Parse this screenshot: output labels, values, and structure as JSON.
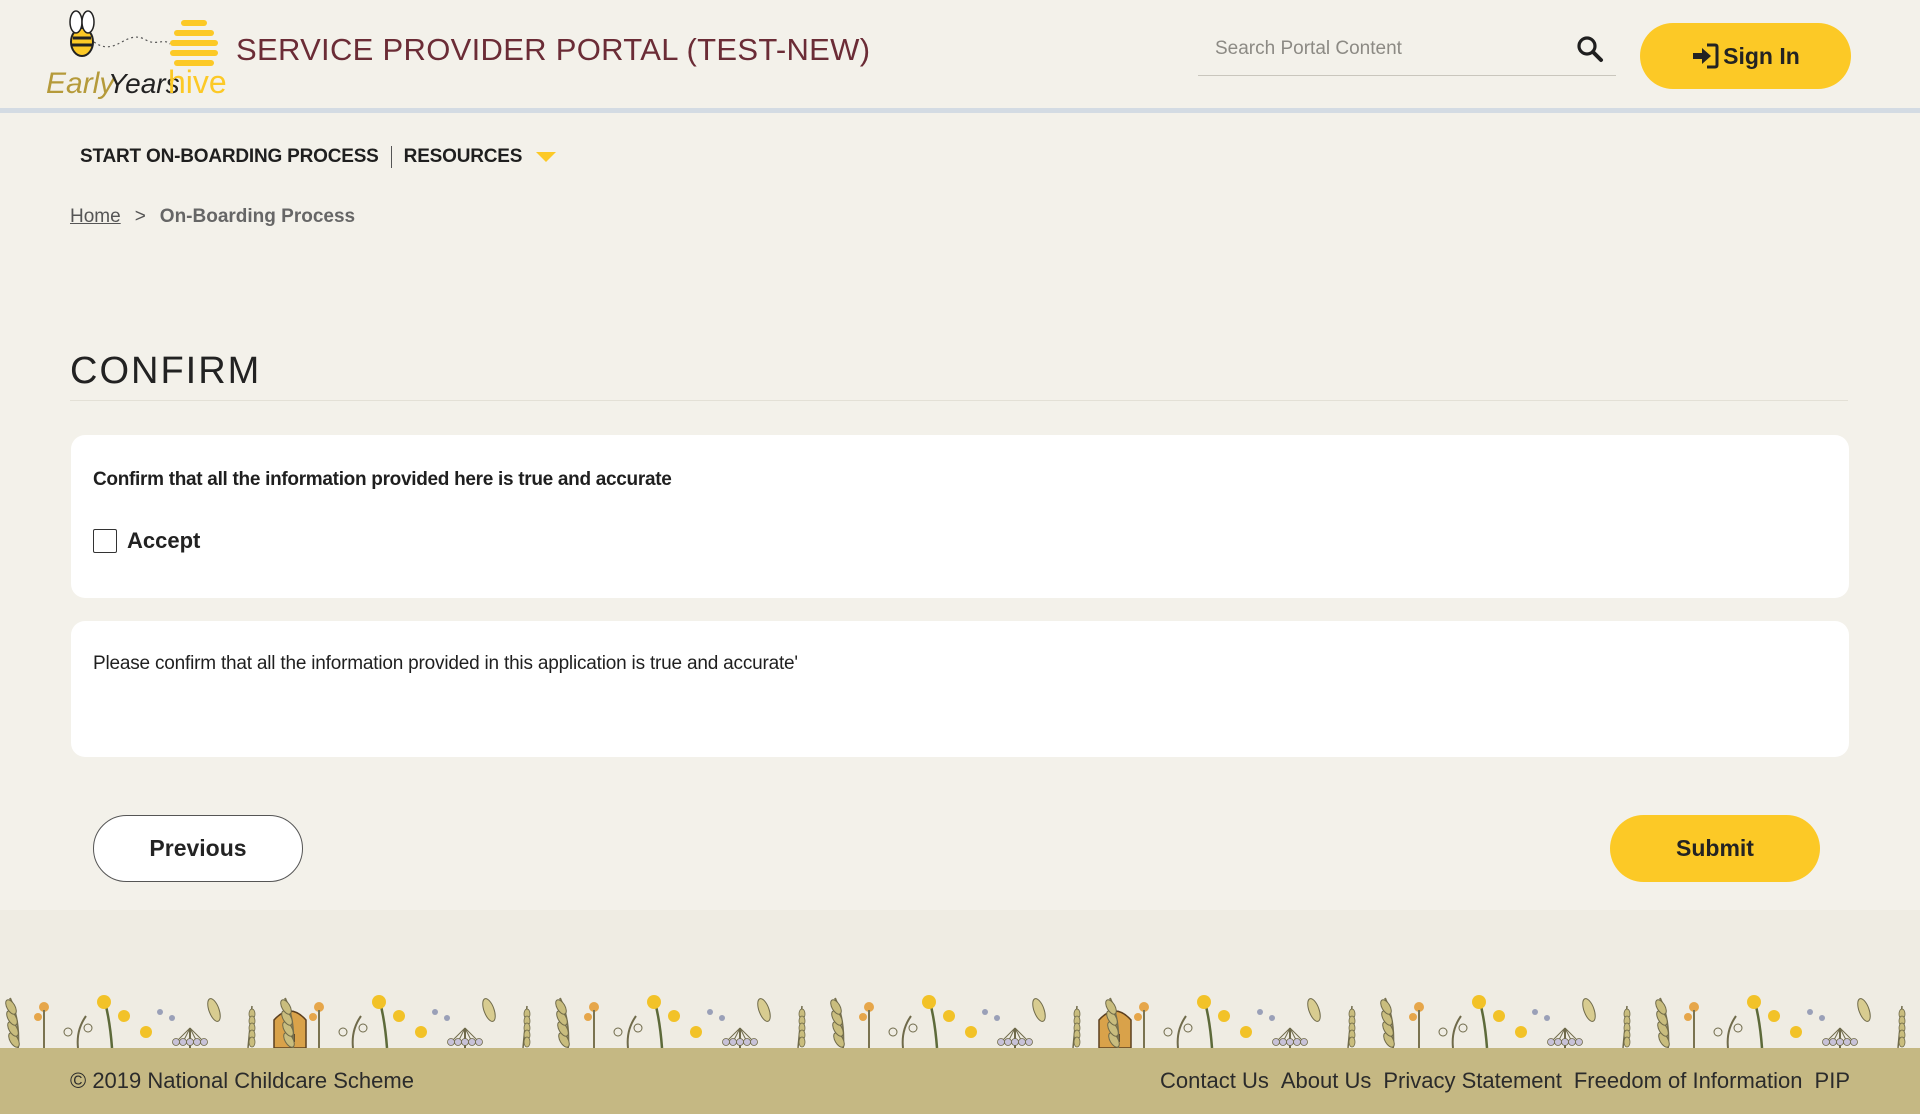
{
  "header": {
    "logo_text_early": "Early",
    "logo_text_years": "Years",
    "logo_text_hive": "hive",
    "title": "SERVICE PROVIDER PORTAL (TEST-NEW)",
    "search_placeholder": "Search Portal Content",
    "signin_label": "Sign In"
  },
  "nav": {
    "items": [
      {
        "label": "START ON-BOARDING PROCESS"
      },
      {
        "label": "RESOURCES"
      }
    ]
  },
  "breadcrumb": {
    "home": "Home",
    "separator": ">",
    "current": "On-Boarding Process"
  },
  "page": {
    "heading": "CONFIRM",
    "confirm_label": "Confirm that all the information provided here is true and accurate",
    "accept_label": "Accept",
    "info_text": "Please confirm that all the information provided in this application is true and accurate'"
  },
  "actions": {
    "previous": "Previous",
    "submit": "Submit"
  },
  "footer": {
    "copyright": "© 2019 National Childcare Scheme",
    "links": [
      "Contact Us",
      "About Us",
      "Privacy Statement",
      "Freedom of Information",
      "PIP"
    ]
  },
  "colors": {
    "accent": "#fcc926",
    "title": "#6b2c36",
    "background": "#f3f1ea",
    "footer": "#c5b883"
  }
}
